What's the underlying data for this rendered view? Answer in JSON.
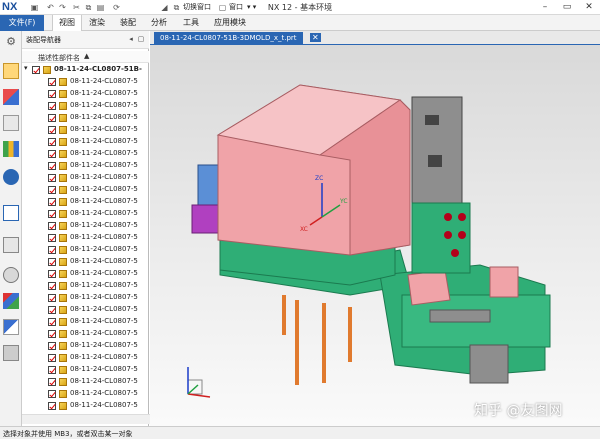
{
  "app": {
    "logo": "NX",
    "window_title": "NX 12 - 基本环境"
  },
  "toolbar": {
    "switch_window": "切换窗口",
    "window": "窗口"
  },
  "menu": {
    "file": "文件(F)",
    "items": [
      "视图",
      "渲染",
      "装配",
      "分析",
      "工具",
      "应用模块"
    ],
    "active": "视图"
  },
  "navigator": {
    "title": "装配导航器",
    "column_header": "描述性部件名",
    "root": "08-11-24-CL0807-51B-",
    "rows": [
      "08-11-24-CL0807-5",
      "08-11-24-CL0807-5",
      "08-11-24-CL0807-5",
      "08-11-24-CL0807-5",
      "08-11-24-CL0807-5",
      "08-11-24-CL0807-5",
      "08-11-24-CL0807-5",
      "08-11-24-CL0807-5",
      "08-11-24-CL0807-5",
      "08-11-24-CL0807-5",
      "08-11-24-CL0807-5",
      "08-11-24-CL0807-5",
      "08-11-24-CL0807-5",
      "08-11-24-CL0807-5",
      "08-11-24-CL0807-5",
      "08-11-24-CL0807-5",
      "08-11-24-CL0807-5",
      "08-11-24-CL0807-5",
      "08-11-24-CL0807-5",
      "08-11-24-CL0807-5",
      "08-11-24-CL0807-5",
      "08-11-24-CL0807-5",
      "08-11-24-CL0807-5",
      "08-11-24-CL0807-5",
      "08-11-24-CL0807-5",
      "08-11-24-CL0807-5",
      "08-11-24-CL0807-5",
      "08-11-24-CL0807-5"
    ]
  },
  "doc_tab": {
    "label": "08-11-24-CL0807-51B-3DMOLD_x_t.prt"
  },
  "triad": {
    "zc": "ZC",
    "yc": "YC",
    "xc": "XC"
  },
  "status": {
    "text": "选择对象并使用 MB3，或者双击某一对象"
  },
  "watermark": "知乎 @友图网",
  "colors": {
    "accent": "#2a66b3",
    "pink": "#f0a3a8",
    "green": "#2fae76",
    "grey": "#8e8e8e",
    "purple": "#b040c0",
    "blue": "#5b8fd6",
    "orange": "#e07a2e"
  }
}
